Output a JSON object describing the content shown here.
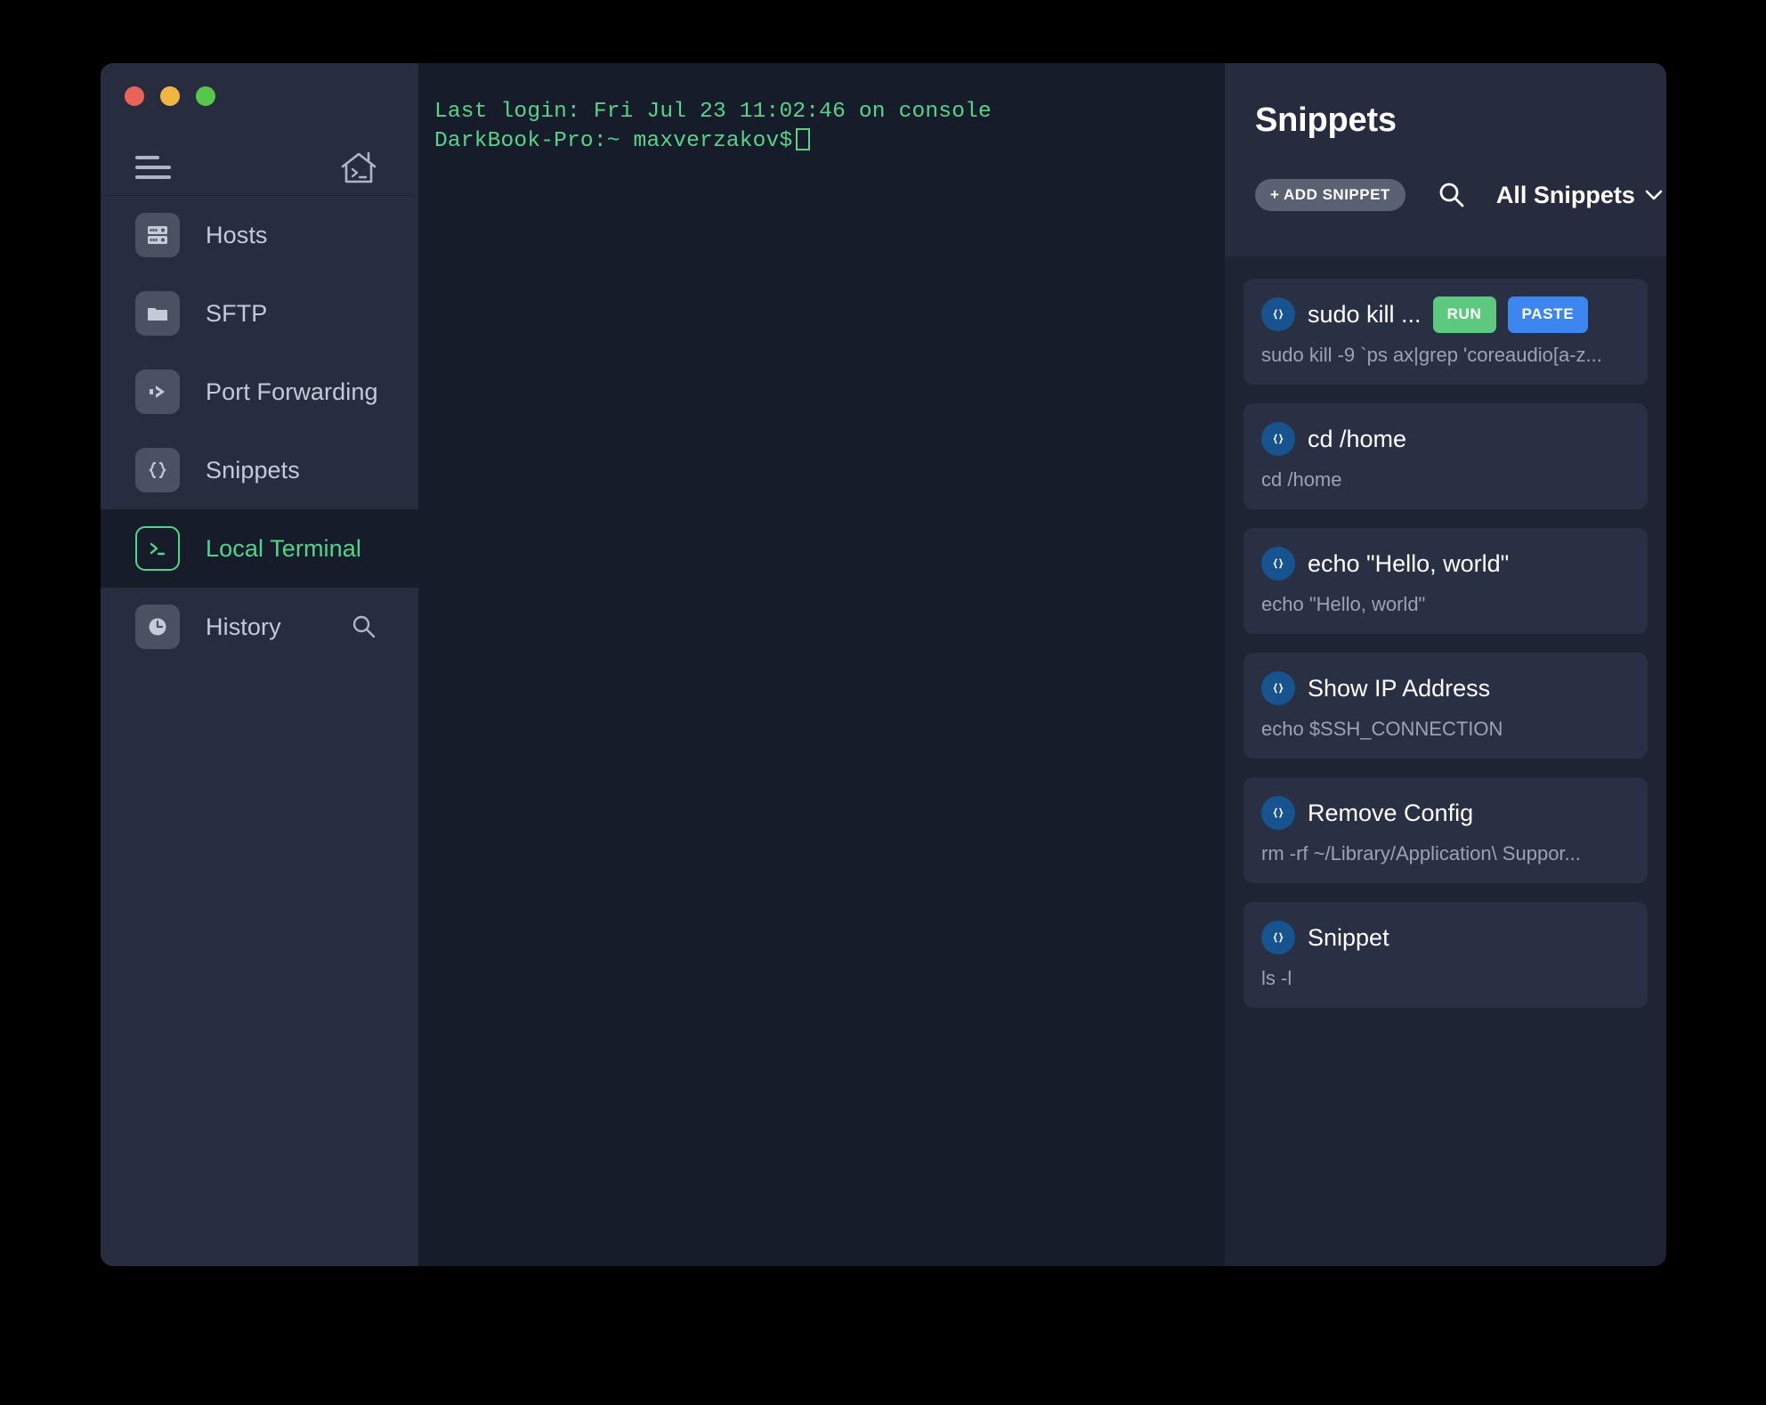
{
  "window": {
    "traffic_lights": [
      {
        "name": "close",
        "color": "#e8645b"
      },
      {
        "name": "minimize",
        "color": "#f1b542"
      },
      {
        "name": "maximize",
        "color": "#55c84b"
      }
    ]
  },
  "sidebar": {
    "menu_icon": "hamburger-icon",
    "home_icon": "home-terminal-icon",
    "items": [
      {
        "label": "Hosts",
        "icon": "server-icon",
        "selected": false
      },
      {
        "label": "SFTP",
        "icon": "folder-icon",
        "selected": false
      },
      {
        "label": "Port Forwarding",
        "icon": "forward-arrow-icon",
        "selected": false
      },
      {
        "label": "Snippets",
        "icon": "braces-icon",
        "selected": false
      },
      {
        "label": "Local Terminal",
        "icon": "terminal-prompt-icon",
        "selected": true
      },
      {
        "label": "History",
        "icon": "clock-icon",
        "selected": false,
        "trailing_icon": "search-icon"
      }
    ]
  },
  "terminal": {
    "lines": [
      "Last login: Fri Jul 23 11:02:46 on console",
      "DarkBook-Pro:~ maxverzakov$"
    ]
  },
  "snippets_panel": {
    "title": "Snippets",
    "add_button": "+ ADD SNIPPET",
    "search_icon": "search-icon",
    "filter_label": "All Snippets",
    "filter_chevron": "chevron-down-icon",
    "items": [
      {
        "name": "sudo kill ...",
        "command": "sudo kill -9 `ps ax|grep 'coreaudio[a-z...",
        "icon": "braces-icon",
        "run_label": "RUN",
        "paste_label": "PASTE",
        "show_actions": true
      },
      {
        "name": "cd /home",
        "command": "cd /home",
        "icon": "braces-icon",
        "show_actions": false
      },
      {
        "name": "echo \"Hello, world\"",
        "command": "echo \"Hello, world\"",
        "icon": "braces-icon",
        "show_actions": false
      },
      {
        "name": "Show IP Address",
        "command": "echo $SSH_CONNECTION",
        "icon": "braces-icon",
        "show_actions": false
      },
      {
        "name": "Remove Config",
        "command": "rm -rf ~/Library/Application\\ Suppor...",
        "icon": "braces-icon",
        "show_actions": false
      },
      {
        "name": "Snippet",
        "command": "ls -l",
        "icon": "braces-icon",
        "show_actions": false
      }
    ]
  },
  "colors": {
    "accent_green": "#4fd787",
    "run_green": "#5cc97f",
    "paste_blue": "#3e86ef",
    "badge_blue": "#17548f",
    "sidebar_bg": "#272d3f",
    "terminal_bg": "#171c2b",
    "panel_bg": "#1f2434",
    "card_bg": "#2a3044",
    "terminal_text": "#57d489"
  }
}
